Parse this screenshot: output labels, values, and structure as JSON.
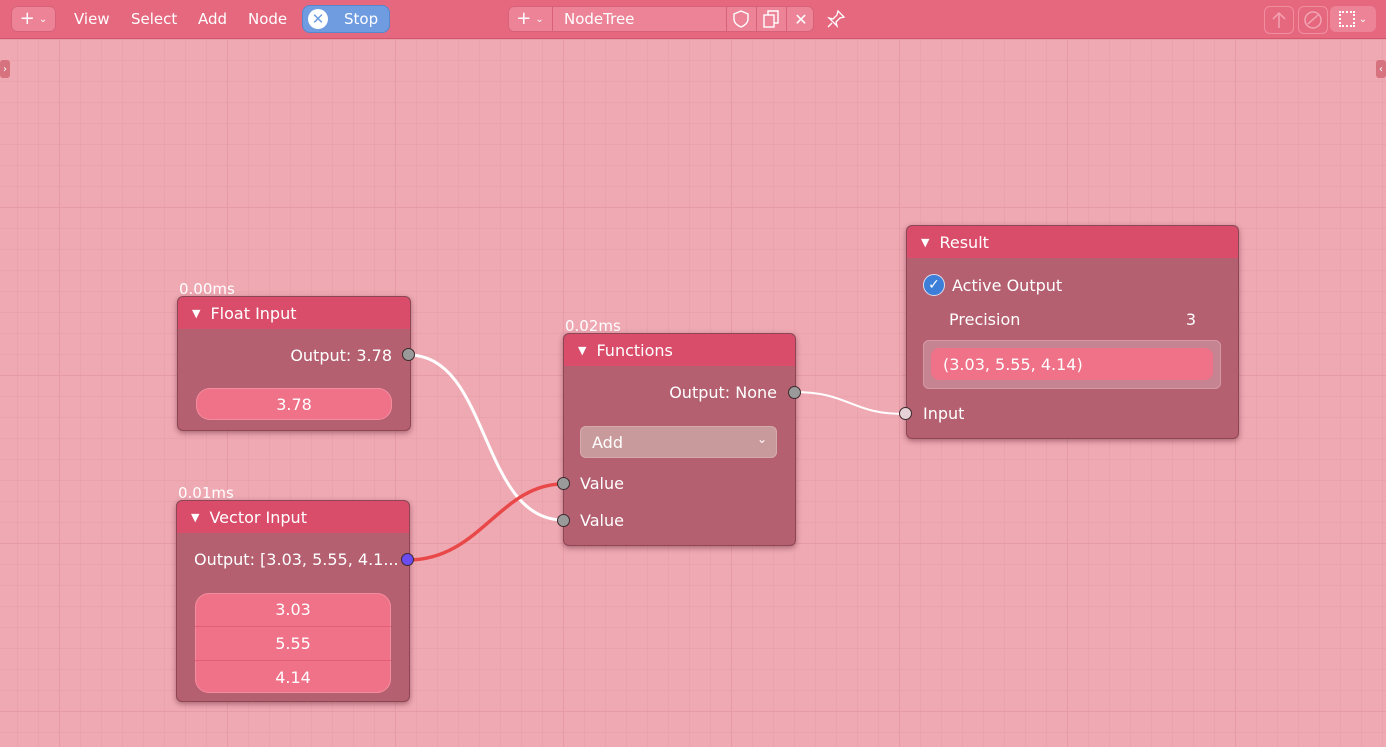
{
  "colors": {
    "background": "#efa9b3",
    "header": "#e6687f",
    "node_body": "#b46070",
    "node_header": "#d94c6a",
    "field": "#ef7288",
    "link_red": "#e94848",
    "link_white": "#ffffff",
    "vector_socket": "#6a4cf0"
  },
  "menu": {
    "view": "View",
    "select": "Select",
    "add": "Add",
    "node": "Node",
    "stop": "Stop"
  },
  "tree": {
    "name": "NodeTree"
  },
  "icons": {
    "new": "plus-icon",
    "shield": "shield-icon",
    "copy": "copy-icon",
    "close": "close-icon",
    "pin": "pin-icon",
    "parent": "parent-icon",
    "overlay": "overlay-icon",
    "snap": "snap-icon"
  },
  "nodes": {
    "float_input": {
      "timing": "0.00ms",
      "title": "Float Input",
      "output": "Output: 3.78",
      "value": "3.78"
    },
    "vector_input": {
      "timing": "0.01ms",
      "title": "Vector Input",
      "output": "Output: [3.03, 5.55, 4.1...",
      "values": [
        "3.03",
        "5.55",
        "4.14"
      ]
    },
    "functions": {
      "timing": "0.02ms",
      "title": "Functions",
      "output": "Output: None",
      "operation": "Add",
      "inputs": [
        "Value",
        "Value"
      ]
    },
    "result": {
      "title": "Result",
      "active_output": "Active Output",
      "active_checked": true,
      "precision_label": "Precision",
      "precision_value": "3",
      "display": "(3.03, 5.55, 4.14)",
      "input": "Input"
    }
  }
}
